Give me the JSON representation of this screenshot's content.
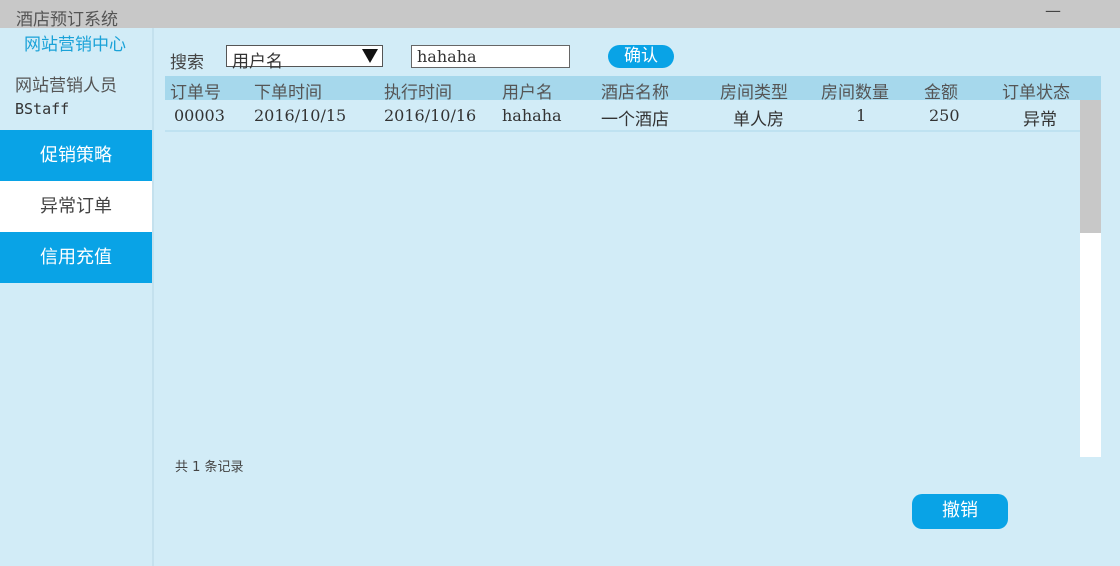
{
  "window": {
    "title": "酒店预订系统",
    "minimize_label": "—"
  },
  "sidebar": {
    "center_title": "网站营销中心",
    "staff_role": "网站营销人员",
    "staff_name": "BStaff",
    "items": [
      {
        "label": "促销策略",
        "active": false
      },
      {
        "label": "异常订单",
        "active": true
      },
      {
        "label": "信用充值",
        "active": false
      }
    ]
  },
  "search": {
    "label": "搜索",
    "field_selected": "用户名",
    "value": "hahaha",
    "confirm_label": "确认"
  },
  "table": {
    "columns": [
      "订单号",
      "下单时间",
      "执行时间",
      "用户名",
      "酒店名称",
      "房间类型",
      "房间数量",
      "金额",
      "订单状态"
    ],
    "rows": [
      [
        "00003",
        "2016/10/15",
        "2016/10/16",
        "hahaha",
        "一个酒店",
        "单人房",
        "1",
        "250",
        "异常"
      ]
    ]
  },
  "footer": {
    "record_count": "共 1 条记录",
    "cancel_label": "撤销"
  },
  "colors": {
    "accent": "#09a3e6",
    "background": "#d2ecf7",
    "header_bg": "#a6d8ec",
    "titlebar": "#c8c8c8"
  }
}
